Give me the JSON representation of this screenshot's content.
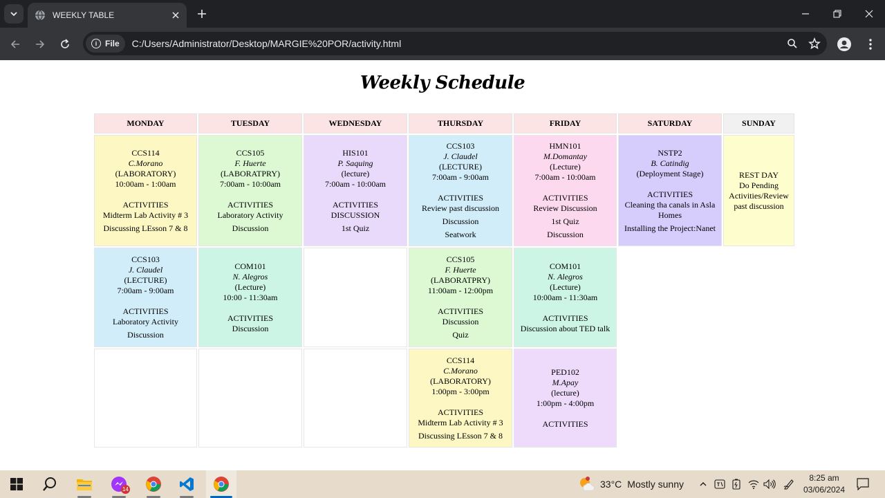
{
  "browser": {
    "tab_title": "WEEKLY TABLE",
    "site_chip": "File",
    "url": "C:/Users/Administrator/Desktop/MARGIE%20POR/activity.html"
  },
  "page": {
    "title": "Weekly Schedule",
    "days": [
      "MONDAY",
      "TUESDAY",
      "WEDNESDAY",
      "THURSDAY",
      "FRIDAY",
      "SATURDAY",
      "SUNDAY"
    ],
    "rows": [
      [
        {
          "code": "CCS114",
          "instructor": "C.Morano",
          "type": "(LABORATORY)",
          "time": "10:00am - 1:00am",
          "activities_label": "ACTIVITIES",
          "activities": [
            "Midterm Lab Activity # 3",
            "Discussing LEsson 7 & 8"
          ]
        },
        {
          "code": "CCS105",
          "instructor": "F. Huerte",
          "type": "(LABORATPRY)",
          "time": "7:00am - 10:00am",
          "activities_label": "ACTIVITIES",
          "activities": [
            "Laboratory Activity",
            "Discussion"
          ]
        },
        {
          "code": "HIS101",
          "instructor": "P. Saquing",
          "type": "(lecture)",
          "time": "7:00am - 10:00am",
          "activities_label": "ACTIVITIES",
          "activities": [
            "DISCUSSION",
            "1st Quiz"
          ]
        },
        {
          "code": "CCS103",
          "instructor": "J. Claudel",
          "type": "(LECTURE)",
          "time": "7:00am - 9:00am",
          "activities_label": "ACTIVITIES",
          "activities": [
            "Review past discussion",
            "Discussion",
            "Seatwork"
          ]
        },
        {
          "code": "HMN101",
          "instructor": "M.Domantay",
          "type": "(Lecture)",
          "time": "7:00am - 10:00am",
          "activities_label": "ACTIVITIES",
          "activities": [
            "Review Discussion",
            "1st Quiz",
            "Discussion"
          ]
        },
        {
          "code": "NSTP2",
          "instructor": "B. Catindig",
          "type": "(Deployment Stage)",
          "time": "",
          "activities_label": "ACTIVITIES",
          "activities": [
            "Cleaning tha canals in Asla Homes",
            "Installing the Project:Nanet"
          ]
        },
        {
          "rest": [
            "REST DAY",
            "Do Pending Activities/Review past discussion"
          ]
        }
      ],
      [
        {
          "code": "CCS103",
          "instructor": "J. Claudel",
          "type": "(LECTURE)",
          "time": "7:00am - 9:00am",
          "activities_label": "ACTIVITIES",
          "activities": [
            "Laboratory Activity",
            "Discussion"
          ]
        },
        {
          "code": "COM101",
          "instructor": "N. Alegros",
          "type": "(Lecture)",
          "time": "10:00 - 11:30am",
          "activities_label": "ACTIVITIES",
          "activities": [
            "Discussion"
          ]
        },
        {
          "empty": true
        },
        {
          "code": "CCS105",
          "instructor": "F. Huerte",
          "type": "(LABORATPRY)",
          "time": "11:00am - 12:00pm",
          "activities_label": "ACTIVITIES",
          "activities": [
            "Discussion",
            "Quiz"
          ]
        },
        {
          "code": "COM101",
          "instructor": "N. Alegros",
          "type": "(Lecture)",
          "time": "10:00am - 11:30am",
          "activities_label": "ACTIVITIES",
          "activities": [
            "Discussion about TED talk"
          ]
        }
      ],
      [
        {
          "empty": true
        },
        {
          "empty": true
        },
        {
          "empty": true
        },
        {
          "code": "CCS114",
          "instructor": "C.Morano",
          "type": "(LABORATORY)",
          "time": "1:00pm - 3:00pm",
          "activities_label": "ACTIVITIES",
          "activities": [
            "Midterm Lab Activity # 3",
            "Discussing LEsson 7 & 8"
          ]
        },
        {
          "code": "PED102",
          "instructor": "M.Apay",
          "type": "(lecture)",
          "time": "1:00pm - 4:00pm",
          "activities_label": "ACTIVITIES",
          "activities": []
        }
      ]
    ]
  },
  "taskbar": {
    "badge_count": "14",
    "weather_temp": "33°C",
    "weather_desc": "Mostly sunny",
    "time": "8:25 am",
    "date": "03/06/2024"
  },
  "colors": {
    "header_pink": "#fde4e4",
    "cell_yellow": "#fdf7c3",
    "cell_green": "#dcf9d3",
    "cell_lavender": "#e9dafb",
    "cell_blue": "#d1edf9",
    "cell_pink": "#fdd9ef",
    "cell_purple": "#d7cdfd",
    "cell_mint": "#cdf5e6"
  }
}
